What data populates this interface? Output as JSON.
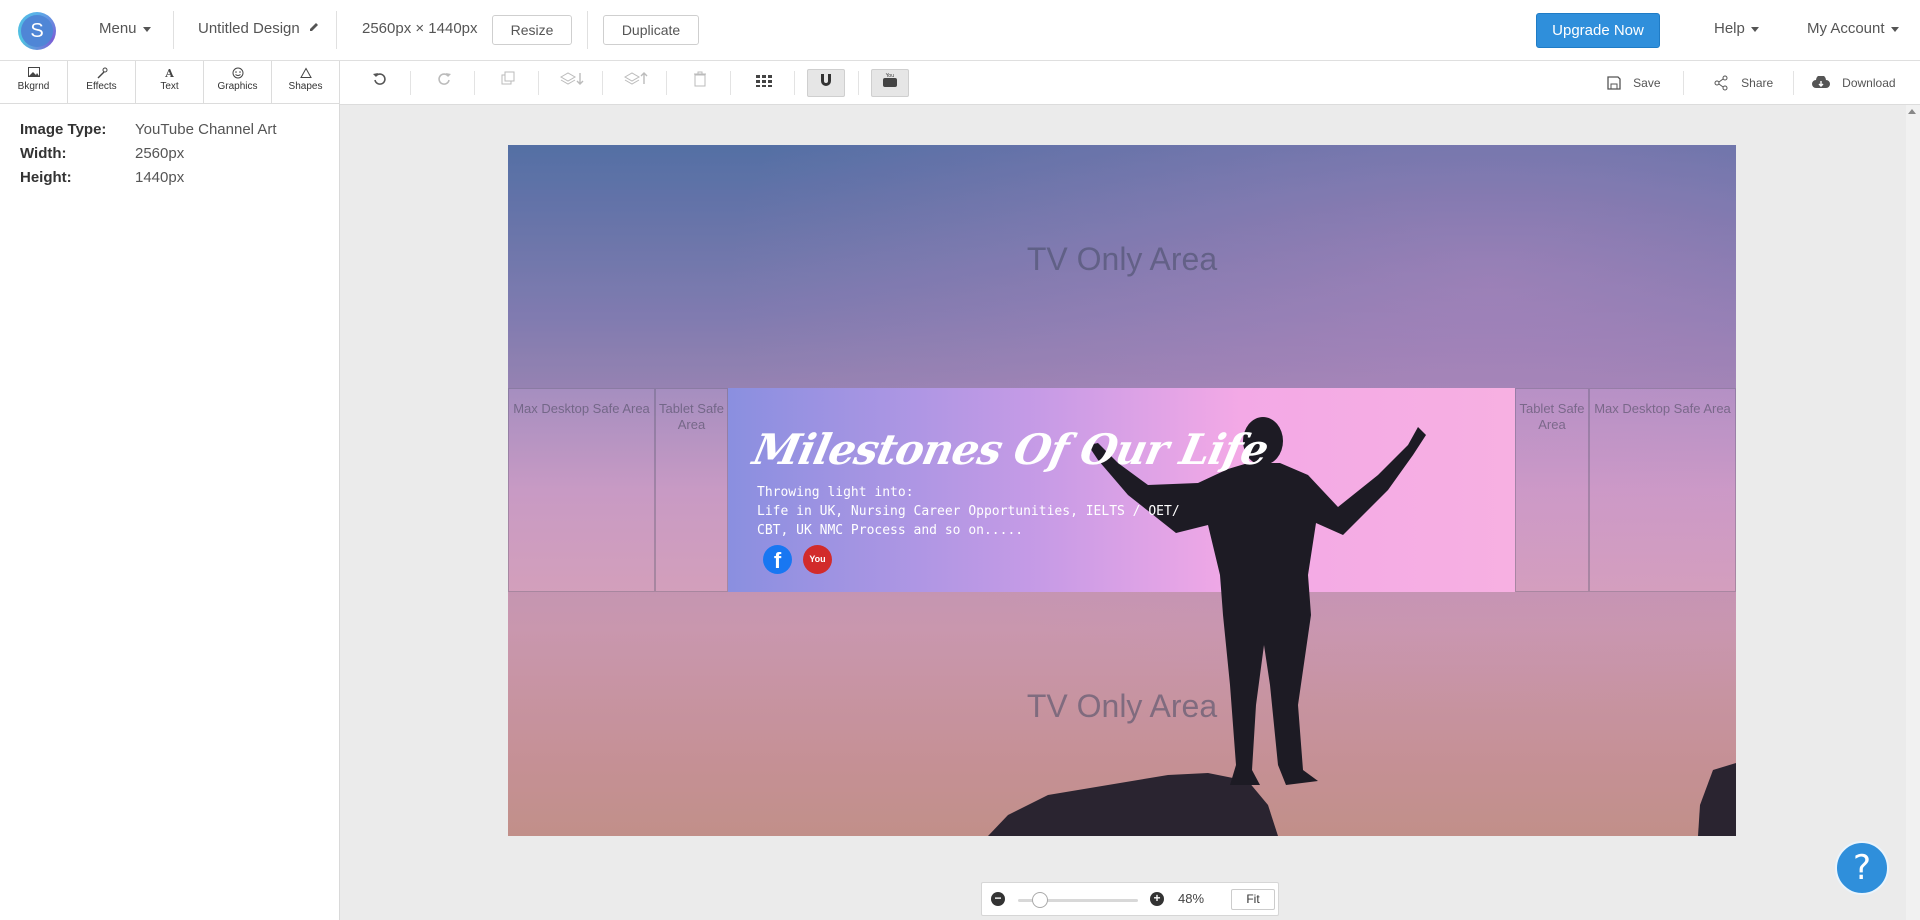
{
  "topbar": {
    "logo_letter": "S",
    "menu_label": "Menu",
    "design_title": "Untitled Design",
    "dimensions": "2560px × 1440px",
    "resize_label": "Resize",
    "duplicate_label": "Duplicate",
    "upgrade_label": "Upgrade Now",
    "help_label": "Help",
    "account_label": "My Account",
    "accent_color": "#2f8fdb"
  },
  "tabs": [
    {
      "label": "Bkgrnd",
      "icon": "image-icon"
    },
    {
      "label": "Effects",
      "icon": "wand-icon"
    },
    {
      "label": "Text",
      "icon": "text-icon"
    },
    {
      "label": "Graphics",
      "icon": "smiley-icon"
    },
    {
      "label": "Shapes",
      "icon": "triangle-icon"
    }
  ],
  "info": {
    "image_type_key": "Image Type:",
    "image_type_val": "YouTube Channel Art",
    "width_key": "Width:",
    "width_val": "2560px",
    "height_key": "Height:",
    "height_val": "1440px"
  },
  "toolbar": {
    "save_label": "Save",
    "share_label": "Share",
    "download_label": "Download"
  },
  "canvas": {
    "tv_top": "TV Only Area",
    "tv_bottom": "TV Only Area",
    "max_desktop_left": "Max Desktop Safe Area",
    "tablet_left": "Tablet Safe Area",
    "tablet_right": "Tablet Safe Area",
    "max_desktop_right": "Max Desktop Safe Area",
    "headline": "Milestones Of Our Life",
    "sub_line1": "Throwing light into:",
    "sub_line2": "Life in UK, Nursing Career Opportunities, IELTS / OET/",
    "sub_line3": "CBT, UK NMC Process and so on.....",
    "facebook_glyph": "f",
    "youtube_glyph": "You"
  },
  "zoom": {
    "percent": "48%",
    "level": 0.48,
    "fit_label": "Fit"
  },
  "help_glyph": "?"
}
